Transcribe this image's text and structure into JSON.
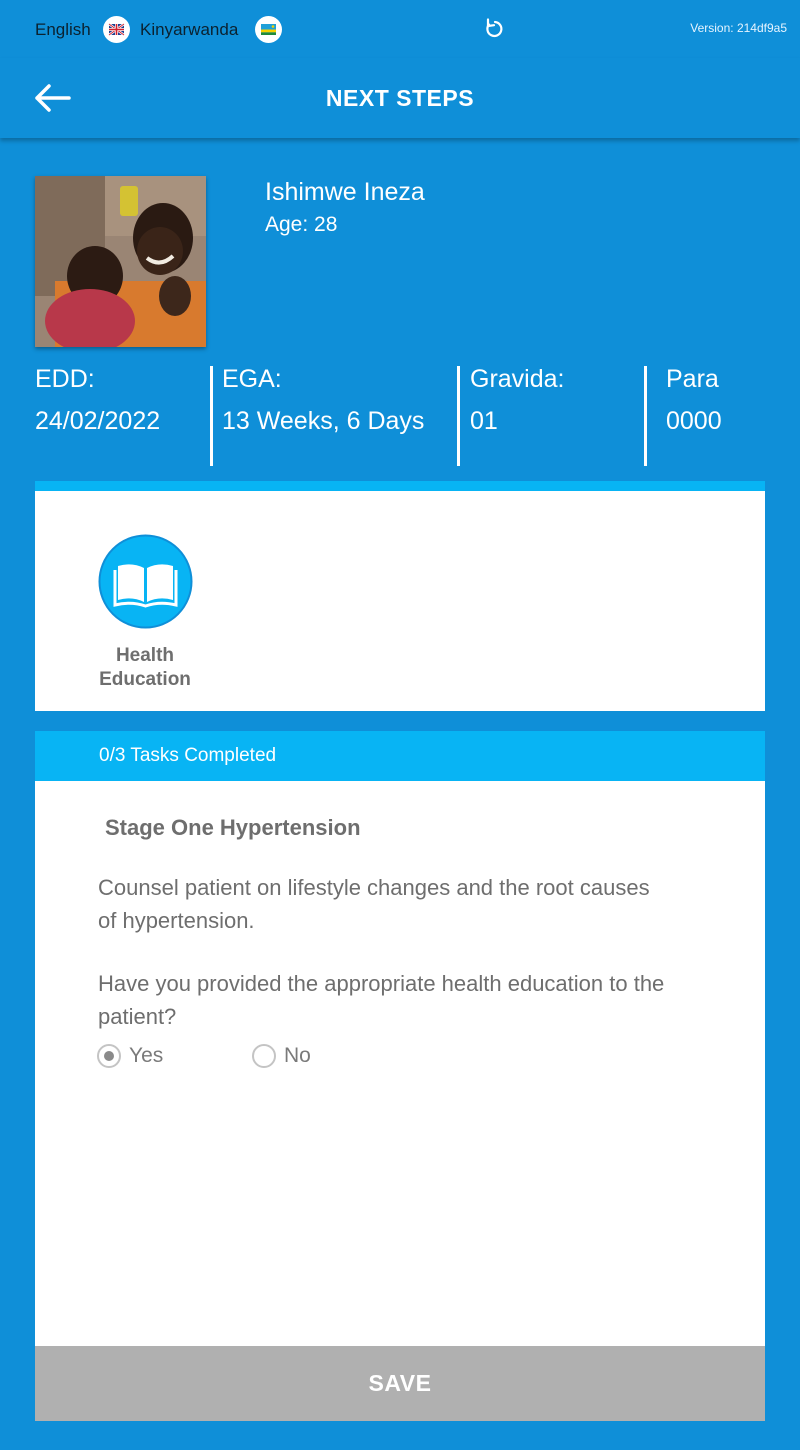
{
  "topbar": {
    "lang_english": "English",
    "lang_kinyarwanda": "Kinyarwanda",
    "version": "Version: 214df9a5",
    "english_flag_icon": "uk-flag-icon",
    "kinyarwanda_flag_icon": "rwanda-flag-icon",
    "refresh_icon": "refresh-icon"
  },
  "header": {
    "title": "NEXT STEPS",
    "back_icon": "arrow-left-icon"
  },
  "patient": {
    "name": "Ishimwe Ineza",
    "age": "Age: 28",
    "stats": [
      {
        "label": "EDD:",
        "value": "24/02/2022"
      },
      {
        "label": "EGA:",
        "value": "13 Weeks, 6 Days"
      },
      {
        "label": "Gravida:",
        "value": "01"
      },
      {
        "label": "Para",
        "value": "0000"
      }
    ]
  },
  "category": {
    "label": "Health Education",
    "icon": "open-book-icon"
  },
  "progress": {
    "text": "0/3 Tasks Completed"
  },
  "task": {
    "title": "Stage One Hypertension",
    "description": "Counsel patient on lifestyle changes and the root causes of hypertension.",
    "question": "Have you provided the appropriate health education to the patient?",
    "options": [
      "Yes",
      "No"
    ],
    "selected": "Yes"
  },
  "actions": {
    "save": "SAVE"
  },
  "colors": {
    "background": "#0f8fd8",
    "accent": "#08b4f4",
    "save_disabled": "#b0b0b0",
    "text_gray": "#6e6e6e"
  }
}
